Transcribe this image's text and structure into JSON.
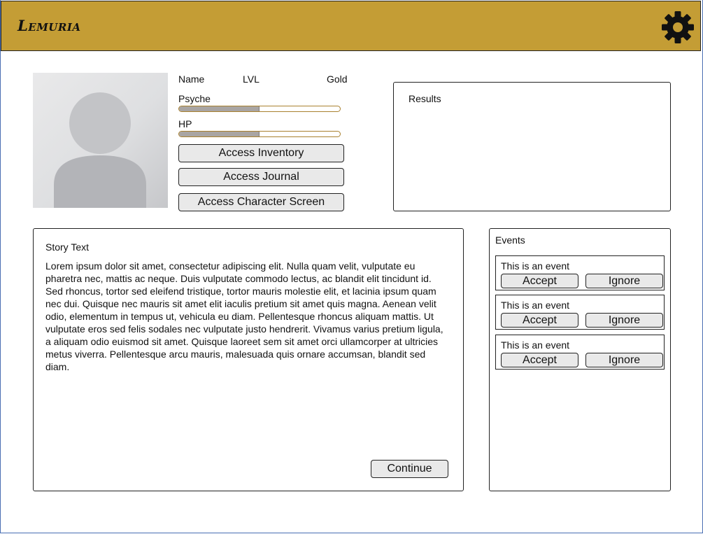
{
  "app": {
    "title": "Lemuria",
    "settings_icon": "gear-icon",
    "header_color": "#c49d35"
  },
  "character": {
    "avatar_icon": "user-silhouette-icon",
    "name_label": "Name",
    "level_label": "LVL",
    "gold_label": "Gold",
    "psyche_label": "Psyche",
    "psyche_value": 0.5,
    "hp_label": "HP",
    "hp_value": 0.5
  },
  "actions": {
    "inventory": "Access Inventory",
    "journal": "Access Journal",
    "character_screen": "Access Character Screen"
  },
  "results": {
    "title": "Results"
  },
  "story": {
    "title": "Story Text",
    "body": "Lorem ipsum dolor sit amet, consectetur adipiscing elit. Nulla quam velit, vulputate eu pharetra nec, mattis ac neque. Duis vulputate commodo lectus, ac blandit elit tincidunt id. Sed rhoncus, tortor sed eleifend tristique, tortor mauris molestie elit, et lacinia ipsum quam nec dui. Quisque nec mauris sit amet elit iaculis pretium sit amet quis magna. Aenean velit odio, elementum in tempus ut, vehicula eu diam. Pellentesque rhoncus aliquam mattis. Ut vulputate eros sed felis sodales nec vulputate justo hendrerit. Vivamus varius pretium ligula, a aliquam odio euismod sit amet. Quisque laoreet sem sit amet orci ullamcorper at ultricies metus viverra. Pellentesque arcu mauris, malesuada quis ornare accumsan, blandit sed diam.",
    "continue_label": "Continue"
  },
  "events": {
    "title": "Events",
    "items": [
      {
        "text": "This is an event",
        "accept": "Accept",
        "ignore": "Ignore"
      },
      {
        "text": "This is an event",
        "accept": "Accept",
        "ignore": "Ignore"
      },
      {
        "text": "This is an event",
        "accept": "Accept",
        "ignore": "Ignore"
      }
    ]
  }
}
